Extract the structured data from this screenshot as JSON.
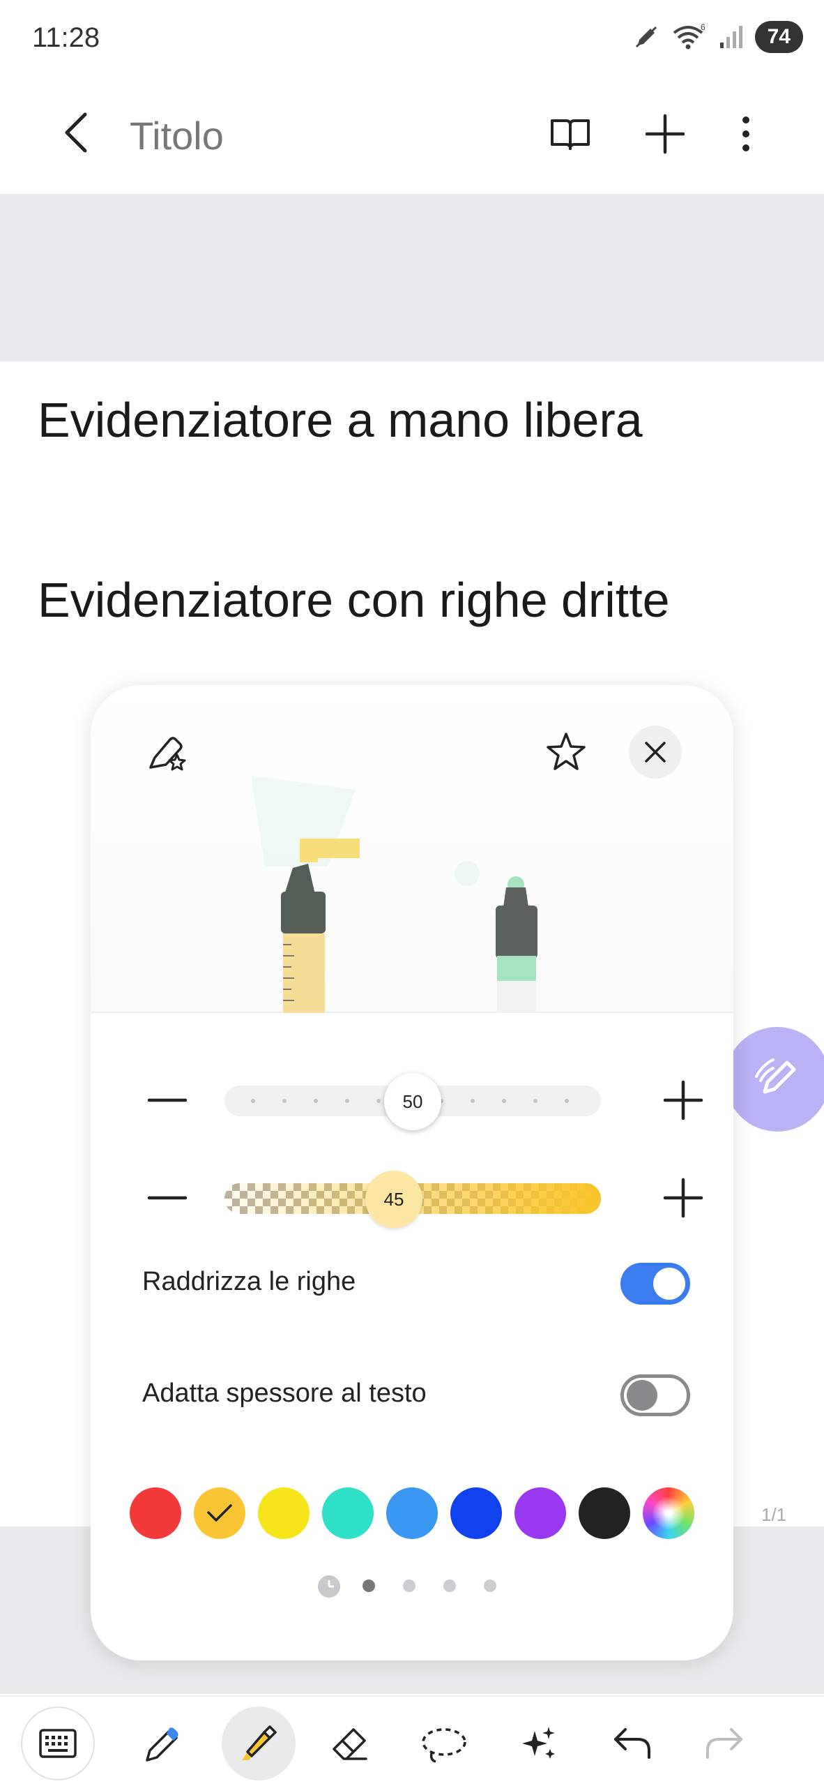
{
  "status_bar": {
    "time": "11:28",
    "battery": "74",
    "wifi_badge": "6"
  },
  "app_bar": {
    "title": "Titolo"
  },
  "content": {
    "line1": "Evidenziatore a mano libera",
    "line2": "Evidenziatore con righe dritte",
    "page_number": "1/1"
  },
  "panel": {
    "size_value": "50",
    "opacity_value": "45",
    "straighten_label": "Raddrizza le righe",
    "straighten_on": true,
    "adapt_label": "Adatta spessore al testo",
    "adapt_on": false,
    "colors": [
      "#f23a3a",
      "#f9c534",
      "#f5e51a",
      "#2ee0c8",
      "#3a97f2",
      "#1141ee",
      "#9a38f0",
      "#222222",
      "rainbow"
    ],
    "selected_color_index": 1,
    "page_dots": 4,
    "active_page_dot": 0
  },
  "accent": "#3b7cf0",
  "icons": {
    "toolbar": [
      "keyboard-icon",
      "pen-icon",
      "highlighter-icon",
      "eraser-icon",
      "lasso-icon",
      "sparkle-icon",
      "undo-icon",
      "redo-icon"
    ]
  }
}
